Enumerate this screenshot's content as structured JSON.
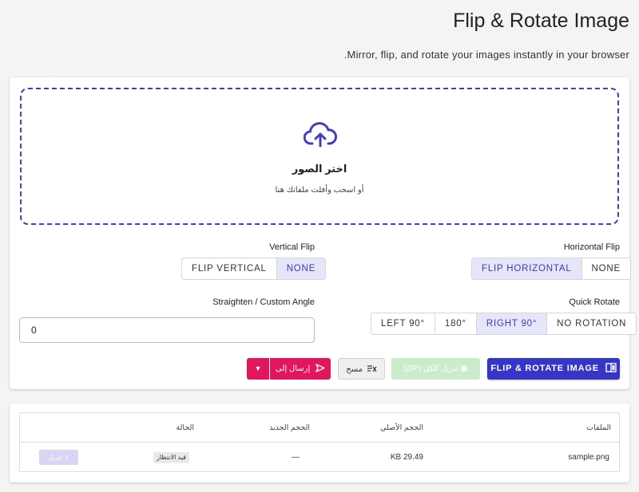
{
  "header": {
    "title": "Flip & Rotate Image",
    "subtitle": ".Mirror, flip, and rotate your images instantly in your browser"
  },
  "dropzone": {
    "icon": "cloud-upload-icon",
    "title": "اختر الصور",
    "subtitle": "أو اسحب وأفلت ملفاتك هنا"
  },
  "controls": {
    "horizontal_flip": {
      "label": "Horizontal Flip",
      "options": [
        "NONE",
        "FLIP HORIZONTAL"
      ],
      "selected": "FLIP HORIZONTAL"
    },
    "vertical_flip": {
      "label": "Vertical Flip",
      "options": [
        "NONE",
        "FLIP VERTICAL"
      ],
      "selected": "NONE"
    },
    "quick_rotate": {
      "label": "Quick Rotate",
      "options": [
        "NO ROTATION",
        "RIGHT 90°",
        "180°",
        "LEFT 90°"
      ],
      "selected": "RIGHT 90°"
    },
    "custom_angle": {
      "label": "Straighten / Custom Angle",
      "value": "0"
    }
  },
  "actions": {
    "process_label": "FLIP & ROTATE IMAGE",
    "zip_label": "(ZIP) تنزيل الكل",
    "clear_label": "مسح",
    "send_label": "إرسال إلى"
  },
  "table": {
    "headers": {
      "files": "الملفات",
      "original_size": "الحجم الأصلي",
      "new_size": "الحجم الجديد",
      "status": "الحالة"
    },
    "rows": [
      {
        "file": "sample.png",
        "original_size": "KB 29.49",
        "new_size": "—",
        "status": "قيد الانتظار",
        "download_label": "تنزيل"
      }
    ]
  },
  "colors": {
    "primary": "#3535c8",
    "send": "#e3155d",
    "zip_disabled": "#c9ecca",
    "active_segment": "#e6e6fa"
  }
}
